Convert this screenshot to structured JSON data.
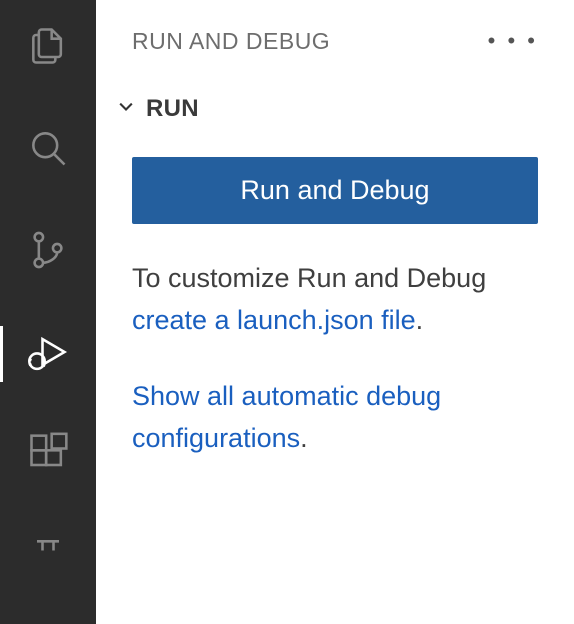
{
  "panel": {
    "title": "RUN AND DEBUG",
    "section_title": "RUN",
    "run_button_label": "Run and Debug",
    "desc_prefix": "To customize Run and Debug ",
    "create_link": "create a launch.json file",
    "desc_suffix": ".",
    "show_all_link": "Show all automatic debug configurations",
    "show_all_suffix": "."
  }
}
